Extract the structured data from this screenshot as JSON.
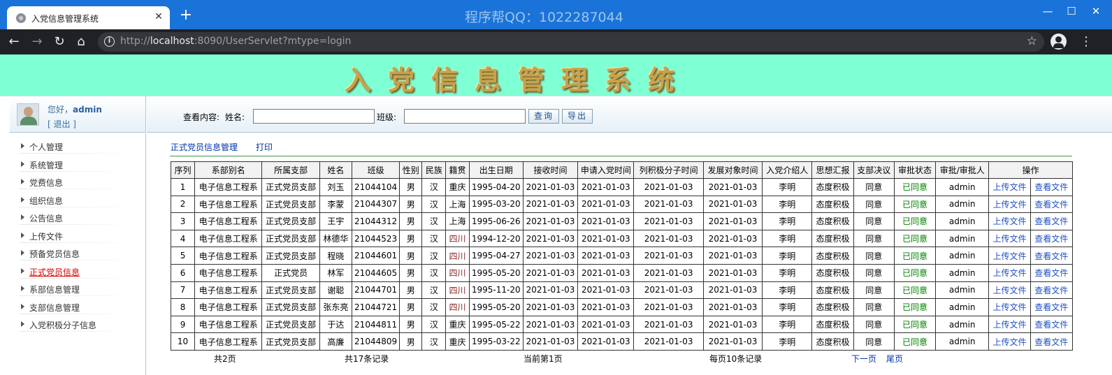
{
  "browser": {
    "tab_title": "入党信息管理系统",
    "watermark": "程序帮QQ：1022287044",
    "url_prefix": "http://",
    "url_host": "localhost",
    "url_rest": ":8090/UserServlet?mtype=login"
  },
  "header": {
    "title": "入党信息管理系统"
  },
  "user": {
    "greeting_prefix": "您好，",
    "name": "admin",
    "logout": "[ 退出 ]"
  },
  "search": {
    "label": "查看内容:",
    "name_label": "姓名:",
    "class_label": "班级:",
    "name_value": "",
    "class_value": "",
    "query_button": "查询",
    "export_button": "导出"
  },
  "sidebar": {
    "items": [
      {
        "label": "个人管理",
        "active": false
      },
      {
        "label": "系统管理",
        "active": false
      },
      {
        "label": "党费信息",
        "active": false
      },
      {
        "label": "组织信息",
        "active": false
      },
      {
        "label": "公告信息",
        "active": false
      },
      {
        "label": "上传文件",
        "active": false
      },
      {
        "label": "预备党员信息",
        "active": false
      },
      {
        "label": "正式党员信息",
        "active": true
      },
      {
        "label": "系部信息管理",
        "active": false
      },
      {
        "label": "支部信息管理",
        "active": false
      },
      {
        "label": "入党积极分子信息",
        "active": false
      }
    ]
  },
  "content": {
    "breadcrumb": "正式党员信息管理",
    "print": "打印"
  },
  "table": {
    "headers": [
      "序列",
      "系部别名",
      "所属支部",
      "姓名",
      "班级",
      "性别",
      "民族",
      "籍贯",
      "出生日期",
      "接收时间",
      "申请入党时间",
      "列积极分子时间",
      "发展对象时间",
      "入党介绍人",
      "思想汇报",
      "支部决议",
      "审批状态",
      "审批/审批人",
      "操作"
    ],
    "upload_label": "上传文件",
    "view_label": "查看文件",
    "rows": [
      [
        "1",
        "电子信息工程系",
        "正式党员支部",
        "刘玉",
        "21044104",
        "男",
        "汉",
        "重庆",
        "1995-04-20",
        "2021-01-03",
        "2021-01-03",
        "2021-01-03",
        "2021-01-03",
        "李明",
        "态度积极",
        "同意",
        "已同意",
        "admin"
      ],
      [
        "2",
        "电子信息工程系",
        "正式党员支部",
        "李蒙",
        "21044307",
        "男",
        "汉",
        "上海",
        "1995-03-20",
        "2021-01-03",
        "2021-01-03",
        "2021-01-03",
        "2021-01-03",
        "李明",
        "态度积极",
        "同意",
        "已同意",
        "admin"
      ],
      [
        "3",
        "电子信息工程系",
        "正式党员支部",
        "王宇",
        "21044312",
        "男",
        "汉",
        "上海",
        "1995-06-26",
        "2021-01-03",
        "2021-01-03",
        "2021-01-03",
        "2021-01-03",
        "李明",
        "态度积极",
        "同意",
        "已同意",
        "admin"
      ],
      [
        "4",
        "电子信息工程系",
        "正式党员支部",
        "林德华",
        "21044523",
        "男",
        "汉",
        "四川",
        "1994-12-20",
        "2021-01-03",
        "2021-01-03",
        "2021-01-03",
        "2021-01-03",
        "李明",
        "态度积极",
        "同意",
        "已同意",
        "admin"
      ],
      [
        "5",
        "电子信息工程系",
        "正式党员支部",
        "程晓",
        "21044601",
        "男",
        "汉",
        "四川",
        "1995-04-27",
        "2021-01-03",
        "2021-01-03",
        "2021-01-03",
        "2021-01-03",
        "李明",
        "态度积极",
        "同意",
        "已同意",
        "admin"
      ],
      [
        "6",
        "电子信息工程系",
        "正式党员",
        "林军",
        "21044605",
        "男",
        "汉",
        "四川",
        "1995-05-20",
        "2021-01-03",
        "2021-01-03",
        "2021-01-03",
        "2021-01-03",
        "李明",
        "态度积极",
        "同意",
        "已同意",
        "admin"
      ],
      [
        "7",
        "电子信息工程系",
        "正式党员支部",
        "谢聪",
        "21044701",
        "男",
        "汉",
        "四川",
        "1995-11-20",
        "2021-01-03",
        "2021-01-03",
        "2021-01-03",
        "2021-01-03",
        "李明",
        "态度积极",
        "同意",
        "已同意",
        "admin"
      ],
      [
        "8",
        "电子信息工程系",
        "正式党员支部",
        "张东亮",
        "21044721",
        "男",
        "汉",
        "四川",
        "1995-05-20",
        "2021-01-03",
        "2021-01-03",
        "2021-01-03",
        "2021-01-03",
        "李明",
        "态度积极",
        "同意",
        "已同意",
        "admin"
      ],
      [
        "9",
        "电子信息工程系",
        "正式党员支部",
        "于达",
        "21044811",
        "男",
        "汉",
        "重庆",
        "1995-05-22",
        "2021-01-03",
        "2021-01-03",
        "2021-01-03",
        "2021-01-03",
        "李明",
        "态度积极",
        "同意",
        "已同意",
        "admin"
      ],
      [
        "10",
        "电子信息工程系",
        "正式党员支部",
        "高廉",
        "21044809",
        "男",
        "汉",
        "重庆",
        "1995-03-22",
        "2021-01-03",
        "2021-01-03",
        "2021-01-03",
        "2021-01-03",
        "李明",
        "态度积极",
        "同意",
        "已同意",
        "admin"
      ]
    ]
  },
  "pagination": {
    "total_pages": "共2页",
    "total_records": "共17条记录",
    "current_page": "当前第1页",
    "per_page": "每页10条记录",
    "next": "下一页",
    "last": "尾页"
  },
  "colors": {
    "titlebar": "#1a73d9",
    "banner": "#7fffd4",
    "approved": "#008000",
    "link": "#1f4fc2",
    "active_nav": "#d40000"
  }
}
